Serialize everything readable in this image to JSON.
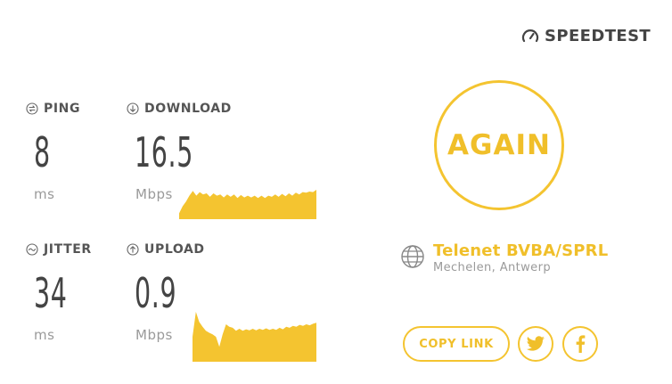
{
  "brand": {
    "name": "SPEEDTEST",
    "icon": "gauge-icon",
    "color": "#444444"
  },
  "metrics": {
    "ping": {
      "label": "PING",
      "value": "8",
      "unit": "ms",
      "icon": "ping-icon"
    },
    "download": {
      "label": "DOWNLOAD",
      "value": "16.5",
      "unit": "Mbps",
      "icon": "download-arrow-icon"
    },
    "jitter": {
      "label": "JITTER",
      "value": "34",
      "unit": "ms",
      "icon": "jitter-icon"
    },
    "upload": {
      "label": "UPLOAD",
      "value": "0.9",
      "unit": "Mbps",
      "icon": "upload-arrow-icon"
    }
  },
  "download_graph": [
    0.1,
    0.22,
    0.3,
    0.4,
    0.48,
    0.4,
    0.46,
    0.42,
    0.44,
    0.38,
    0.44,
    0.4,
    0.42,
    0.37,
    0.42,
    0.38,
    0.42,
    0.36,
    0.41,
    0.37,
    0.4,
    0.37,
    0.4,
    0.36,
    0.4,
    0.36,
    0.4,
    0.38,
    0.42,
    0.38,
    0.43,
    0.39,
    0.44,
    0.4,
    0.45,
    0.42,
    0.46,
    0.45,
    0.47,
    0.46,
    0.5
  ],
  "upload_graph": [
    0.5,
    1.0,
    0.8,
    0.7,
    0.62,
    0.58,
    0.55,
    0.5,
    0.3,
    0.55,
    0.75,
    0.7,
    0.68,
    0.62,
    0.66,
    0.62,
    0.65,
    0.63,
    0.66,
    0.63,
    0.66,
    0.64,
    0.67,
    0.64,
    0.66,
    0.64,
    0.68,
    0.65,
    0.7,
    0.68,
    0.72,
    0.7,
    0.74,
    0.72,
    0.75,
    0.73,
    0.76,
    0.78
  ],
  "again_button": {
    "label": "AGAIN"
  },
  "isp": {
    "name": "Telenet BVBA/SPRL",
    "location": "Mechelen, Antwerp",
    "icon": "globe-icon"
  },
  "share": {
    "copy_link_label": "COPY LINK",
    "twitter_icon": "twitter-icon",
    "facebook_icon": "facebook-icon"
  },
  "colors": {
    "accent": "#f4c430",
    "text": "#444444",
    "muted": "#9a9a9a"
  }
}
